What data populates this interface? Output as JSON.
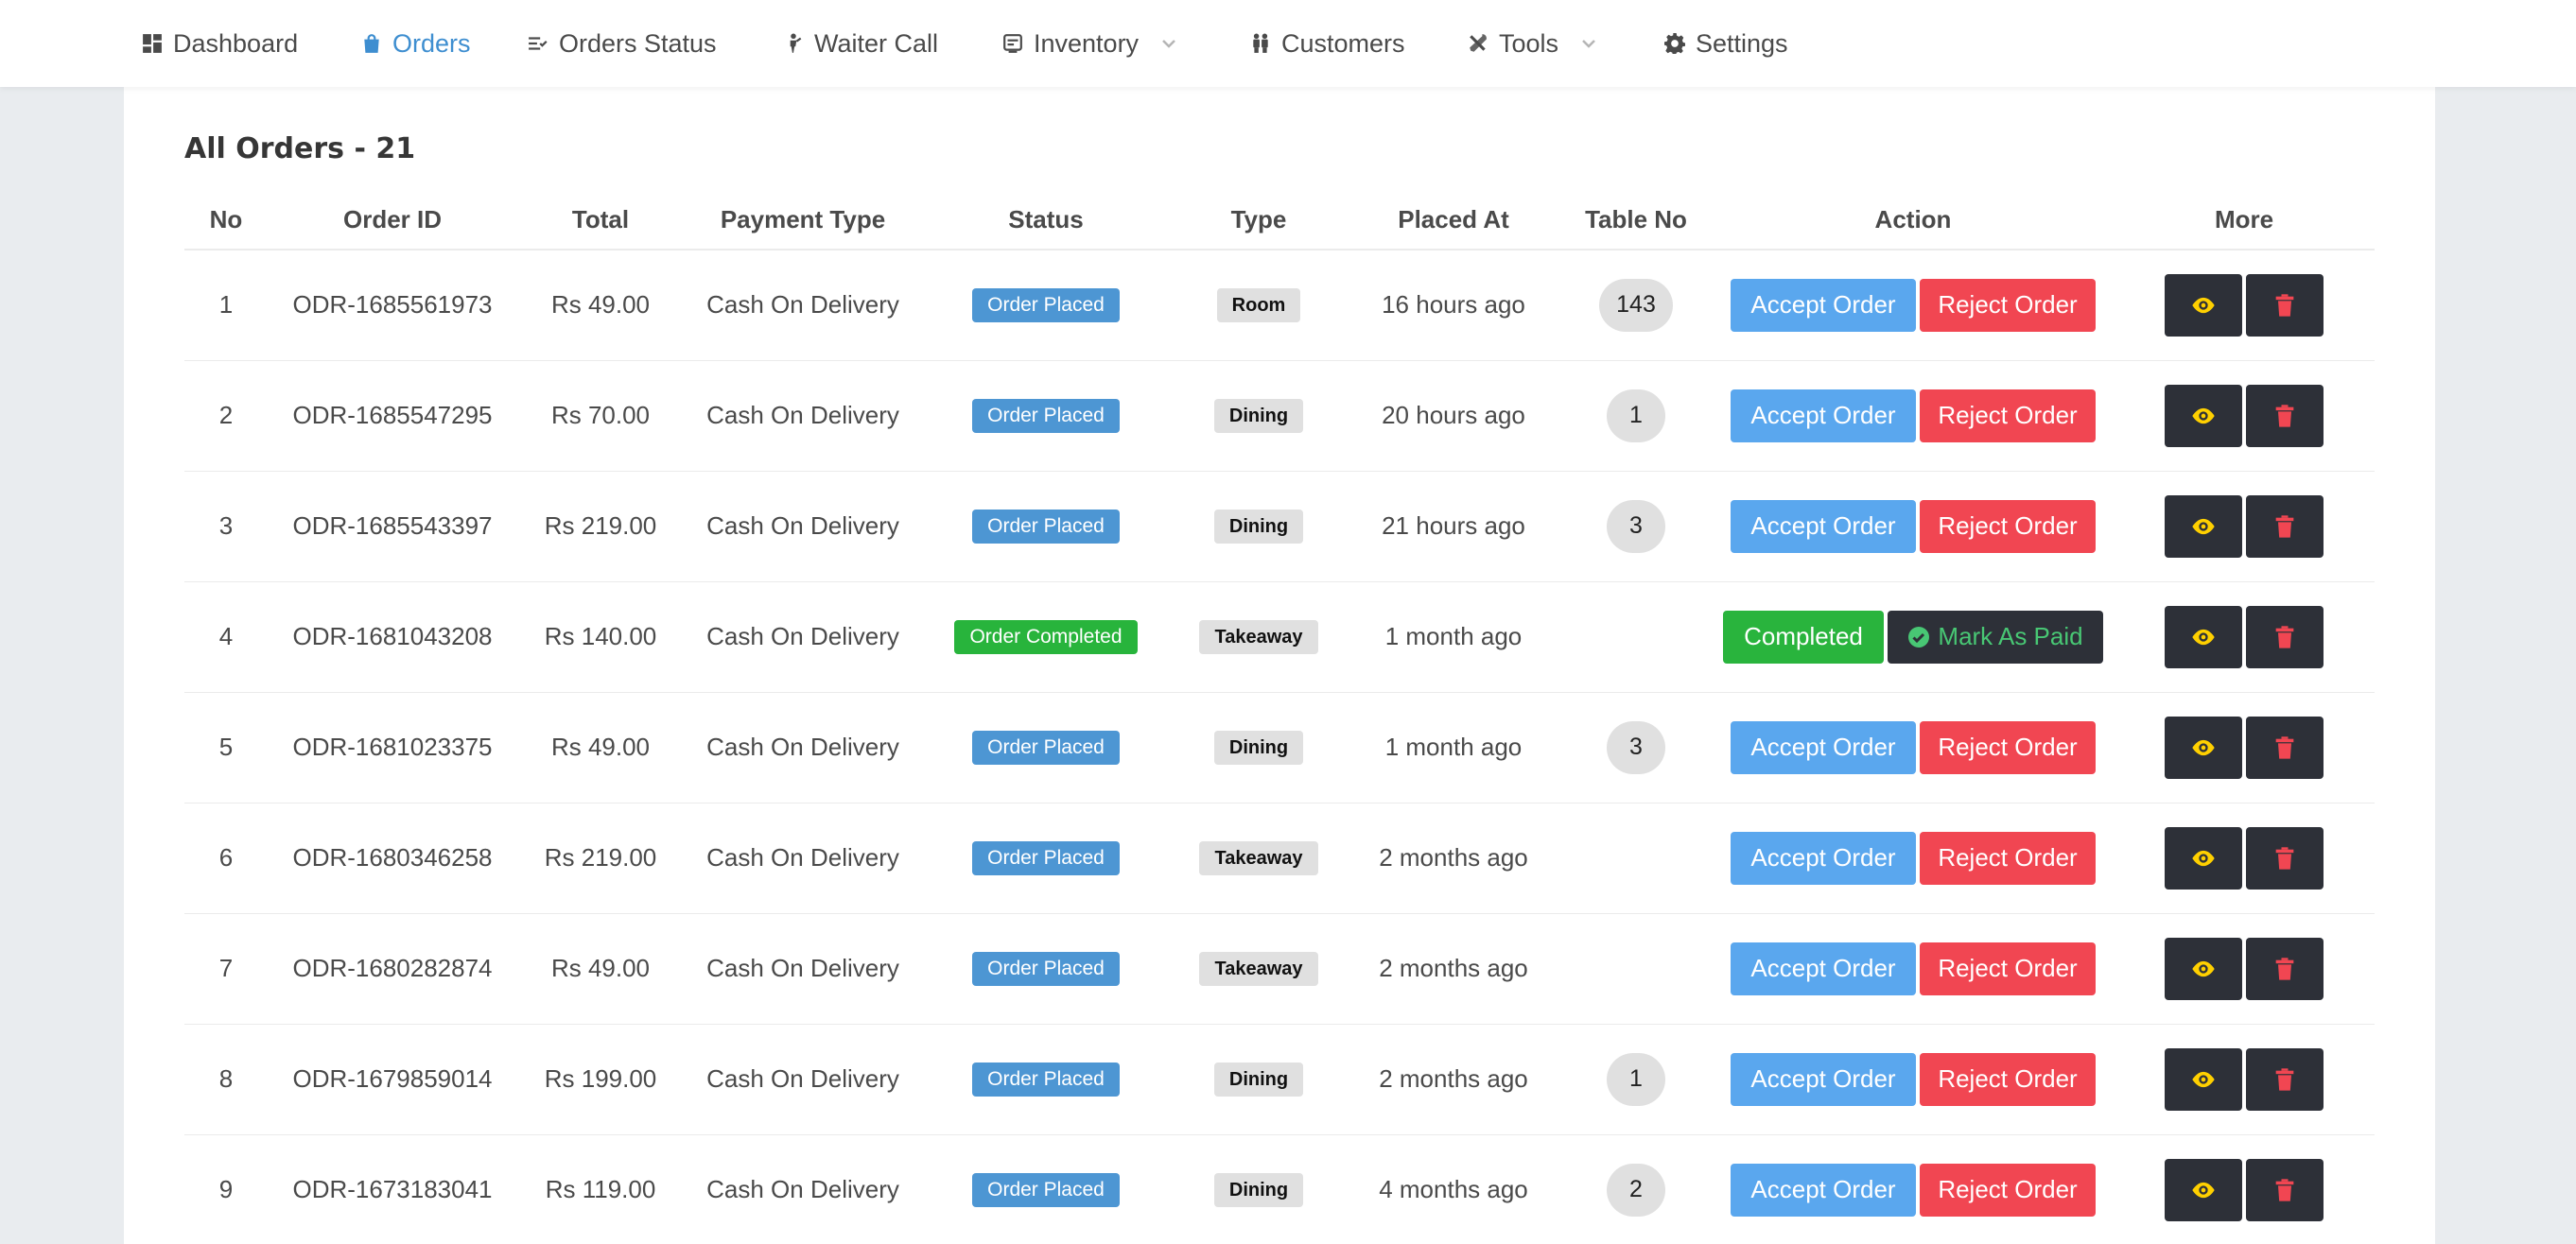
{
  "nav": [
    {
      "label": "Dashboard",
      "icon": "dashboard-icon",
      "active": false,
      "dropdown": false
    },
    {
      "label": "Orders",
      "icon": "shopping-bag-icon",
      "active": true,
      "dropdown": false
    },
    {
      "label": "Orders Status",
      "icon": "list-check-icon",
      "active": false,
      "dropdown": false
    },
    {
      "label": "Waiter Call",
      "icon": "waiter-icon",
      "active": false,
      "dropdown": false
    },
    {
      "label": "Inventory",
      "icon": "inventory-icon",
      "active": false,
      "dropdown": true
    },
    {
      "label": "Customers",
      "icon": "users-icon",
      "active": false,
      "dropdown": false
    },
    {
      "label": "Tools",
      "icon": "tools-icon",
      "active": false,
      "dropdown": true
    },
    {
      "label": "Settings",
      "icon": "gear-icon",
      "active": false,
      "dropdown": false
    }
  ],
  "page": {
    "title": "All Orders - 21"
  },
  "table": {
    "headers": [
      "No",
      "Order ID",
      "Total",
      "Payment Type",
      "Status",
      "Type",
      "Placed At",
      "Table No",
      "Action",
      "More"
    ],
    "buttons": {
      "accept": "Accept Order",
      "reject": "Reject Order",
      "completed": "Completed",
      "paid": "Mark As Paid"
    },
    "rows": [
      {
        "no": "1",
        "order_id": "ODR-1685561973",
        "total": "Rs 49.00",
        "payment": "Cash On Delivery",
        "status": "Order Placed",
        "type": "Room",
        "placed_at": "16 hours ago",
        "table_no": "143",
        "completed": false
      },
      {
        "no": "2",
        "order_id": "ODR-1685547295",
        "total": "Rs 70.00",
        "payment": "Cash On Delivery",
        "status": "Order Placed",
        "type": "Dining",
        "placed_at": "20 hours ago",
        "table_no": "1",
        "completed": false
      },
      {
        "no": "3",
        "order_id": "ODR-1685543397",
        "total": "Rs 219.00",
        "payment": "Cash On Delivery",
        "status": "Order Placed",
        "type": "Dining",
        "placed_at": "21 hours ago",
        "table_no": "3",
        "completed": false
      },
      {
        "no": "4",
        "order_id": "ODR-1681043208",
        "total": "Rs 140.00",
        "payment": "Cash On Delivery",
        "status": "Order Completed",
        "type": "Takeaway",
        "placed_at": "1 month ago",
        "table_no": "",
        "completed": true
      },
      {
        "no": "5",
        "order_id": "ODR-1681023375",
        "total": "Rs 49.00",
        "payment": "Cash On Delivery",
        "status": "Order Placed",
        "type": "Dining",
        "placed_at": "1 month ago",
        "table_no": "3",
        "completed": false
      },
      {
        "no": "6",
        "order_id": "ODR-1680346258",
        "total": "Rs 219.00",
        "payment": "Cash On Delivery",
        "status": "Order Placed",
        "type": "Takeaway",
        "placed_at": "2 months ago",
        "table_no": "",
        "completed": false
      },
      {
        "no": "7",
        "order_id": "ODR-1680282874",
        "total": "Rs 49.00",
        "payment": "Cash On Delivery",
        "status": "Order Placed",
        "type": "Takeaway",
        "placed_at": "2 months ago",
        "table_no": "",
        "completed": false
      },
      {
        "no": "8",
        "order_id": "ODR-1679859014",
        "total": "Rs 199.00",
        "payment": "Cash On Delivery",
        "status": "Order Placed",
        "type": "Dining",
        "placed_at": "2 months ago",
        "table_no": "1",
        "completed": false
      },
      {
        "no": "9",
        "order_id": "ODR-1673183041",
        "total": "Rs 119.00",
        "payment": "Cash On Delivery",
        "status": "Order Placed",
        "type": "Dining",
        "placed_at": "4 months ago",
        "table_no": "2",
        "completed": false
      }
    ]
  },
  "colors": {
    "accent": "#3e8ed0",
    "accept": "#5aa7ee",
    "reject": "#f14652",
    "success": "#29b43d",
    "dark": "#2d3038",
    "eye": "#ffd000",
    "trash": "#f14652"
  }
}
